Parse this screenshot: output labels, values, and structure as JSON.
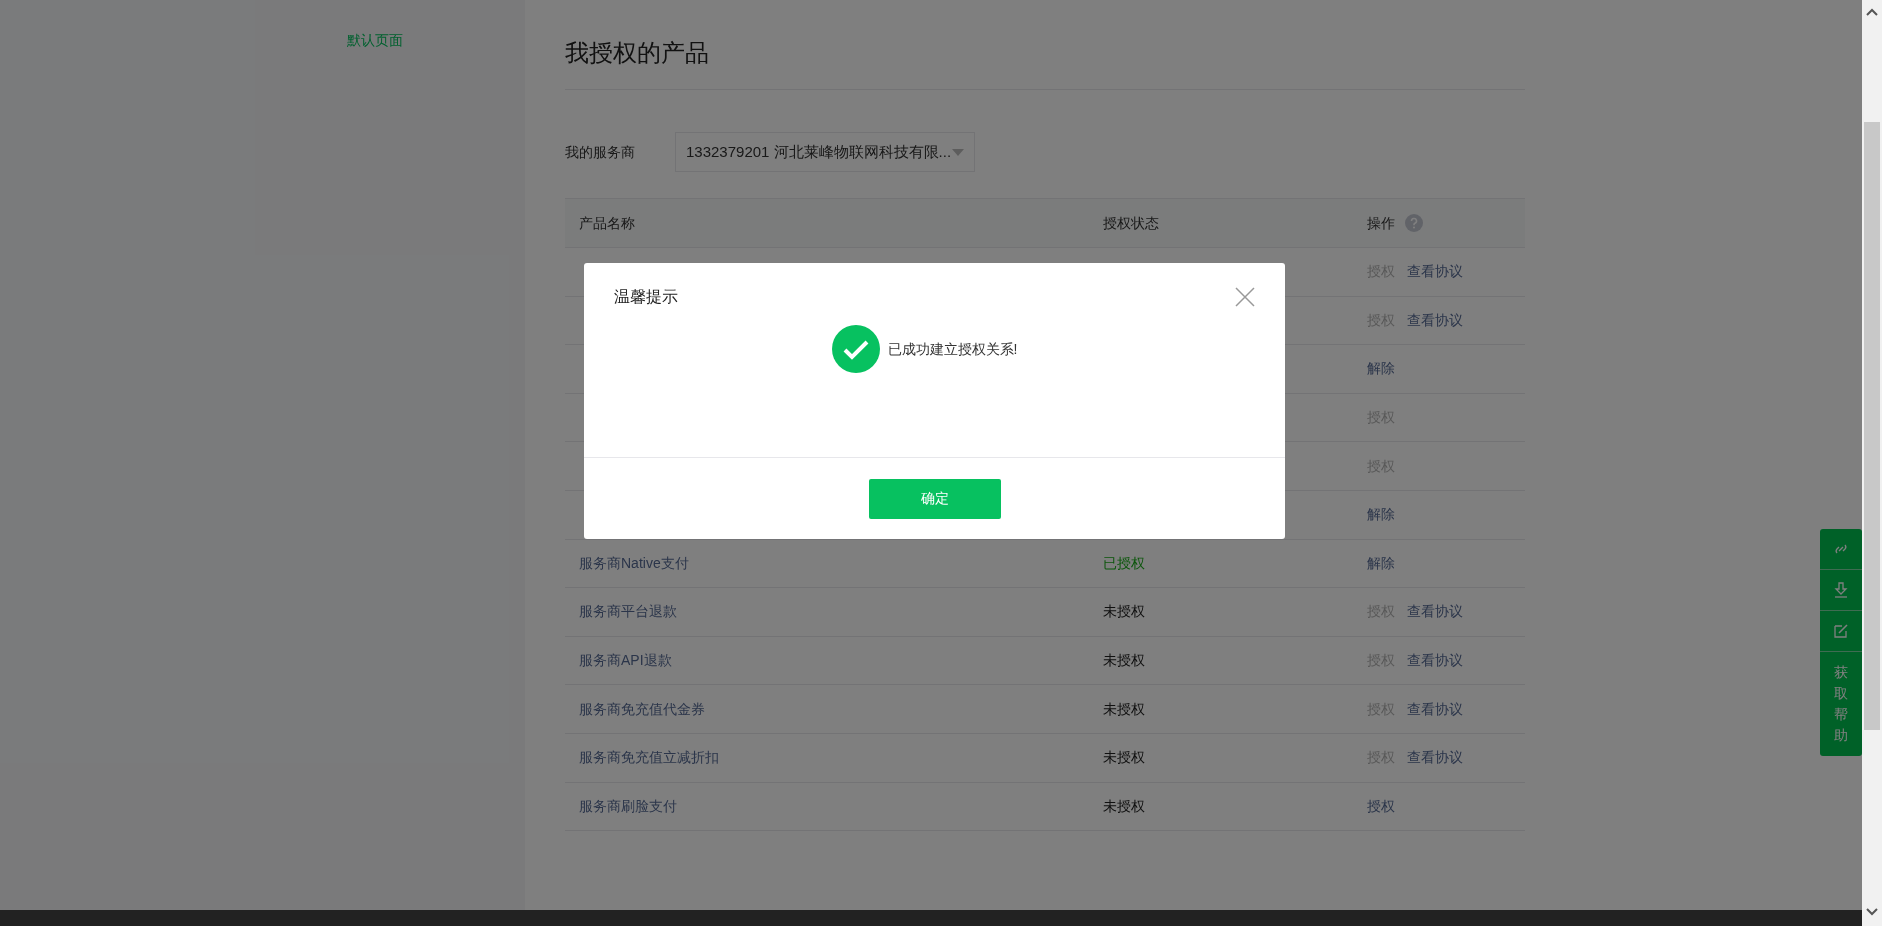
{
  "sidebar": {
    "items": [
      {
        "label": "默认页面",
        "selected": true
      }
    ]
  },
  "page_title": "我授权的产品",
  "provider_select": {
    "label": "我的服务商",
    "value": "1332379201 河北莱峰物联网科技有限..."
  },
  "table": {
    "columns": [
      "产品名称",
      "授权状态",
      "操作"
    ],
    "rows": [
      {
        "actions": [
          {
            "label": "授权",
            "enabled": false
          },
          {
            "label": "查看协议",
            "enabled": true
          }
        ]
      },
      {
        "actions": [
          {
            "label": "授权",
            "enabled": false
          },
          {
            "label": "查看协议",
            "enabled": true
          }
        ]
      },
      {
        "actions": [
          {
            "label": "解除",
            "enabled": true
          }
        ]
      },
      {
        "actions": [
          {
            "label": "授权",
            "enabled": false
          }
        ]
      },
      {
        "actions": [
          {
            "label": "授权",
            "enabled": false
          }
        ]
      },
      {
        "actions": [
          {
            "label": "解除",
            "enabled": true
          }
        ]
      },
      {
        "name": "服务商Native支付",
        "status": {
          "text": "已授权",
          "kind": "authorized"
        },
        "actions": [
          {
            "label": "解除",
            "enabled": true
          }
        ]
      },
      {
        "name": "服务商平台退款",
        "status": {
          "text": "未授权",
          "kind": "unauthorized"
        },
        "actions": [
          {
            "label": "授权",
            "enabled": false
          },
          {
            "label": "查看协议",
            "enabled": true
          }
        ]
      },
      {
        "name": "服务商API退款",
        "status": {
          "text": "未授权",
          "kind": "unauthorized"
        },
        "actions": [
          {
            "label": "授权",
            "enabled": false
          },
          {
            "label": "查看协议",
            "enabled": true
          }
        ]
      },
      {
        "name": "服务商免充值代金券",
        "status": {
          "text": "未授权",
          "kind": "unauthorized"
        },
        "actions": [
          {
            "label": "授权",
            "enabled": false
          },
          {
            "label": "查看协议",
            "enabled": true
          }
        ]
      },
      {
        "name": "服务商免充值立减折扣",
        "status": {
          "text": "未授权",
          "kind": "unauthorized"
        },
        "actions": [
          {
            "label": "授权",
            "enabled": false
          },
          {
            "label": "查看协议",
            "enabled": true
          }
        ]
      },
      {
        "name": "服务商刷脸支付",
        "status": {
          "text": "未授权",
          "kind": "unauthorized"
        },
        "actions": [
          {
            "label": "授权",
            "enabled": true
          }
        ]
      }
    ]
  },
  "help_widget": {
    "label": "获取帮助"
  },
  "dialog": {
    "title": "温馨提示",
    "message": "已成功建立授权关系!",
    "confirm": "确定"
  }
}
